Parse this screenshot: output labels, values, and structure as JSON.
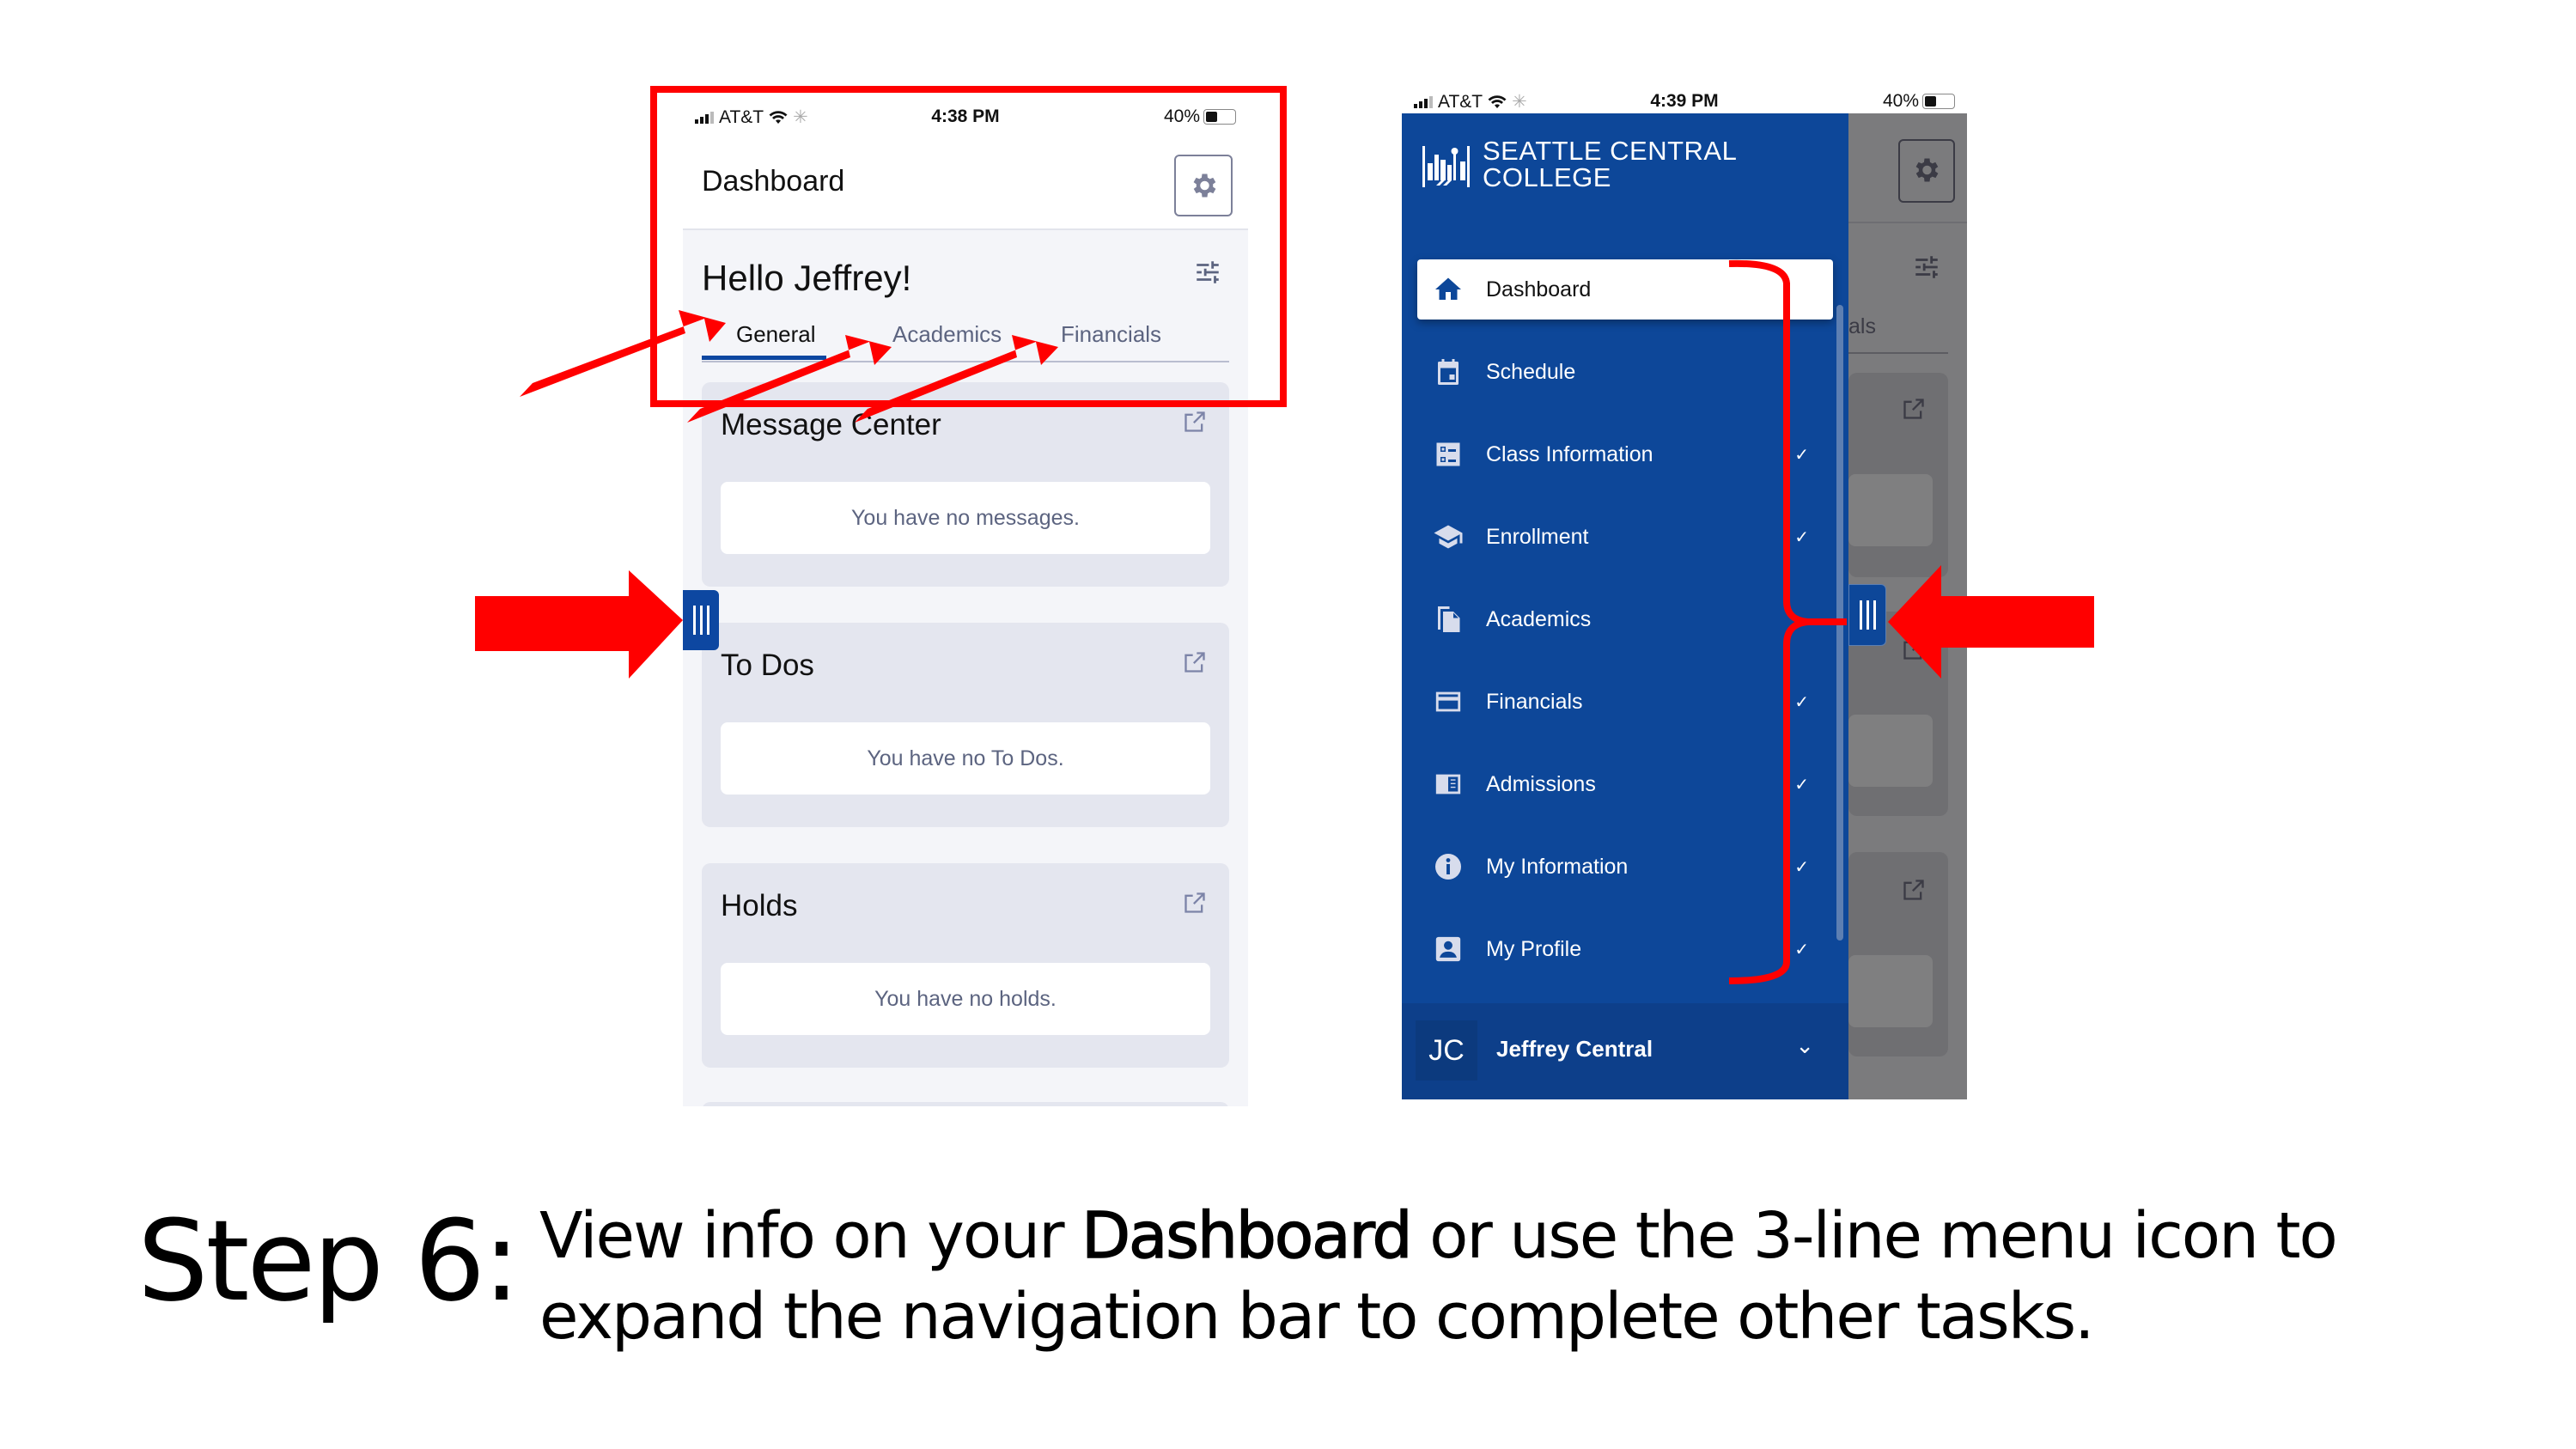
{
  "colors": {
    "brand_blue": "#0d4799",
    "annotation_red": "#ff0000",
    "card_bg": "#e4e6ef",
    "muted_text": "#5c6480"
  },
  "left_phone": {
    "status": {
      "carrier": "AT&T",
      "time": "4:38 PM",
      "battery": "40%"
    },
    "header": {
      "title": "Dashboard",
      "settings_icon": "gear-icon"
    },
    "greeting": "Hello Jeffrey!",
    "tabs": [
      {
        "label": "General",
        "active": true
      },
      {
        "label": "Academics",
        "active": false
      },
      {
        "label": "Financials",
        "active": false
      }
    ],
    "cards": [
      {
        "title": "Message Center",
        "empty_text": "You have no messages."
      },
      {
        "title": "To Dos",
        "empty_text": "You have no To Dos."
      },
      {
        "title": "Holds",
        "empty_text": "You have no holds."
      }
    ],
    "menu_handle_icon": "three-line-menu-icon"
  },
  "right_phone": {
    "status": {
      "carrier": "AT&T",
      "time": "4:39 PM",
      "battery": "40%"
    },
    "logo": {
      "line1": "SEATTLE CENTRAL",
      "line2": "COLLEGE"
    },
    "nav": [
      {
        "label": "Dashboard",
        "icon": "home-icon",
        "active": true,
        "expandable": false
      },
      {
        "label": "Schedule",
        "icon": "calendar-icon",
        "active": false,
        "expandable": false
      },
      {
        "label": "Class Information",
        "icon": "list-icon",
        "active": false,
        "expandable": true
      },
      {
        "label": "Enrollment",
        "icon": "graduation-cap-icon",
        "active": false,
        "expandable": true
      },
      {
        "label": "Academics",
        "icon": "documents-icon",
        "active": false,
        "expandable": false
      },
      {
        "label": "Financials",
        "icon": "credit-card-icon",
        "active": false,
        "expandable": true
      },
      {
        "label": "Admissions",
        "icon": "book-icon",
        "active": false,
        "expandable": true
      },
      {
        "label": "My Information",
        "icon": "info-icon",
        "active": false,
        "expandable": true
      },
      {
        "label": "My Profile",
        "icon": "profile-icon",
        "active": false,
        "expandable": true
      }
    ],
    "user": {
      "initials": "JC",
      "name": "Jeffrey Central"
    },
    "peek_tab_fragment": "als"
  },
  "caption": {
    "step": "Step 6:",
    "text_before": "View info on your ",
    "text_bold": "Dashboard",
    "text_after": " or use the 3-line menu icon to expand the navigation bar to complete other tasks."
  }
}
